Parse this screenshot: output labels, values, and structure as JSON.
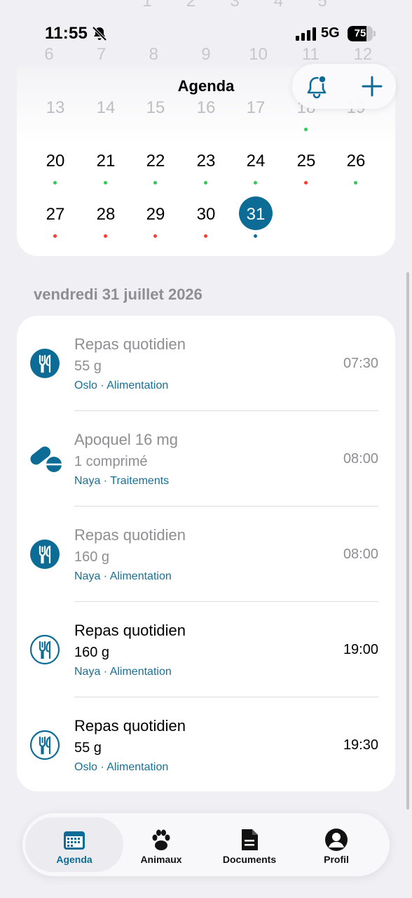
{
  "status_bar": {
    "time": "11:55",
    "network": "5G",
    "battery": "75",
    "battery_level": 0.75
  },
  "header": {
    "title": "Agenda"
  },
  "colors": {
    "accent": "#0d6c95",
    "dot_green": "#34c759",
    "dot_red": "#ff3b30"
  },
  "calendar": {
    "faded_rows": [
      [
        "1",
        "2",
        "3",
        "4",
        "5"
      ],
      [
        "6",
        "7",
        "8",
        "9",
        "10",
        "11",
        "12"
      ],
      [
        "13",
        "14",
        "15",
        "16",
        "17",
        "18",
        "19"
      ]
    ],
    "week_a": [
      {
        "day": "20",
        "dot": "green"
      },
      {
        "day": "21",
        "dot": "green"
      },
      {
        "day": "22",
        "dot": "green"
      },
      {
        "day": "23",
        "dot": "green"
      },
      {
        "day": "24",
        "dot": "green"
      },
      {
        "day": "25",
        "dot": "red"
      },
      {
        "day": "26",
        "dot": "green"
      }
    ],
    "week_b": [
      {
        "day": "27",
        "dot": "red"
      },
      {
        "day": "28",
        "dot": "red"
      },
      {
        "day": "29",
        "dot": "red"
      },
      {
        "day": "30",
        "dot": "red"
      },
      {
        "day": "31",
        "dot": "accent",
        "selected": true
      }
    ]
  },
  "date_header": "vendredi 31 juillet 2026",
  "events": [
    {
      "title": "Repas quotidien",
      "detail": "55 g",
      "tags": "Oslo · Alimentation",
      "time": "07:30",
      "icon": "fork-knife-icon",
      "done": true
    },
    {
      "title": "Apoquel 16 mg",
      "detail": "1 comprimé",
      "tags": "Naya · Traitements",
      "time": "08:00",
      "icon": "pill-icon",
      "done": true
    },
    {
      "title": "Repas quotidien",
      "detail": "160 g",
      "tags": "Naya · Alimentation",
      "time": "08:00",
      "icon": "fork-knife-icon",
      "done": true
    },
    {
      "title": "Repas quotidien",
      "detail": "160 g",
      "tags": "Naya · Alimentation",
      "time": "19:00",
      "icon": "fork-knife-outline-icon",
      "done": false
    },
    {
      "title": "Repas quotidien",
      "detail": "55 g",
      "tags": "Oslo · Alimentation",
      "time": "19:30",
      "icon": "fork-knife-outline-icon",
      "done": false
    }
  ],
  "tabs": [
    {
      "label": "Agenda",
      "icon": "calendar-icon",
      "active": true
    },
    {
      "label": "Animaux",
      "icon": "paw-icon",
      "active": false
    },
    {
      "label": "Documents",
      "icon": "document-icon",
      "active": false
    },
    {
      "label": "Profil",
      "icon": "profile-icon",
      "active": false
    }
  ]
}
